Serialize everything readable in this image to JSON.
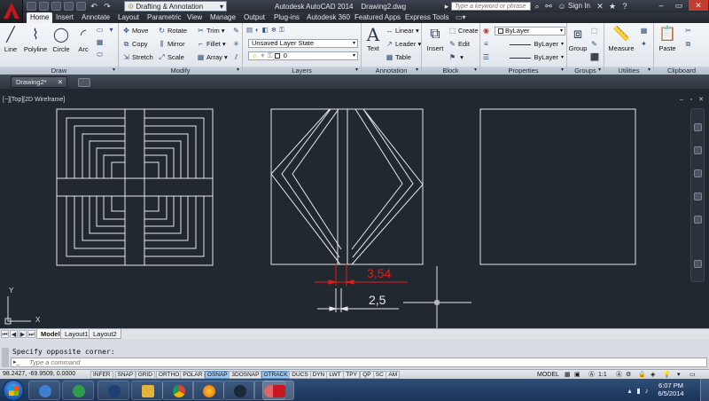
{
  "titlebar": {
    "workspace": "Drafting & Annotation",
    "app_title": "Autodesk AutoCAD 2014",
    "file_title": "Drawing2.dwg",
    "search_placeholder": "Type a keyword or phrase",
    "signin": "Sign In"
  },
  "tabs": [
    "Home",
    "Insert",
    "Annotate",
    "Layout",
    "Parametric",
    "View",
    "Manage",
    "Output",
    "Plug-ins",
    "Autodesk 360",
    "Featured Apps",
    "Express Tools"
  ],
  "ribbon": {
    "draw": {
      "label": "Draw",
      "line": "Line",
      "polyline": "Polyline",
      "circle": "Circle",
      "arc": "Arc"
    },
    "modify": {
      "label": "Modify",
      "move": "Move",
      "rotate": "Rotate",
      "trim": "Trim",
      "copy": "Copy",
      "mirror": "Mirror",
      "fillet": "Fillet",
      "stretch": "Stretch",
      "scale": "Scale",
      "array": "Array"
    },
    "layers": {
      "label": "Layers",
      "layer_state": "Unsaved Layer State",
      "current_layer": "0"
    },
    "annotation": {
      "label": "Annotation",
      "text": "Text",
      "linear": "Linear",
      "leader": "Leader",
      "table": "Table"
    },
    "block": {
      "label": "Block",
      "insert": "Insert",
      "create": "Create",
      "edit": "Edit"
    },
    "properties": {
      "label": "Properties",
      "color": "ByLayer",
      "lineweight": "ByLayer",
      "linetype": "ByLayer"
    },
    "groups": {
      "label": "Groups",
      "group": "Group"
    },
    "utilities": {
      "label": "Utilities",
      "measure": "Measure"
    },
    "clipboard": {
      "label": "Clipboard",
      "paste": "Paste"
    }
  },
  "file_tab": "Drawing2*",
  "viewport_label": "[−][Top][2D Wireframe]",
  "dimensions": {
    "red": "3,54",
    "white": "2,5"
  },
  "layout_tabs": [
    "Model",
    "Layout1",
    "Layout2"
  ],
  "command": {
    "history": "Specify opposite corner:",
    "placeholder": "Type a command"
  },
  "status": {
    "coords": "98.2427, -69.9509, 0.0000",
    "toggles": [
      {
        "label": "INFER",
        "on": false
      },
      {
        "label": "SNAP",
        "on": false
      },
      {
        "label": "GRID",
        "on": false
      },
      {
        "label": "ORTHO",
        "on": false
      },
      {
        "label": "POLAR",
        "on": false
      },
      {
        "label": "OSNAP",
        "on": true
      },
      {
        "label": "3DOSNAP",
        "on": false
      },
      {
        "label": "OTRACK",
        "on": true
      },
      {
        "label": "DUCS",
        "on": false
      },
      {
        "label": "DYN",
        "on": false
      },
      {
        "label": "LWT",
        "on": false
      },
      {
        "label": "TPY",
        "on": false
      },
      {
        "label": "QP",
        "on": false
      },
      {
        "label": "SC",
        "on": false
      },
      {
        "label": "AM",
        "on": false
      }
    ],
    "model": "MODEL",
    "scale": "1:1"
  },
  "taskbar": {
    "time": "6:07 PM",
    "date": "6/5/2014"
  },
  "colors": {
    "canvas_bg": "#212830",
    "line_white": "#e6e8ea",
    "dim_red": "#e21b1b",
    "ribbon_accent": "#9fc6ea"
  }
}
